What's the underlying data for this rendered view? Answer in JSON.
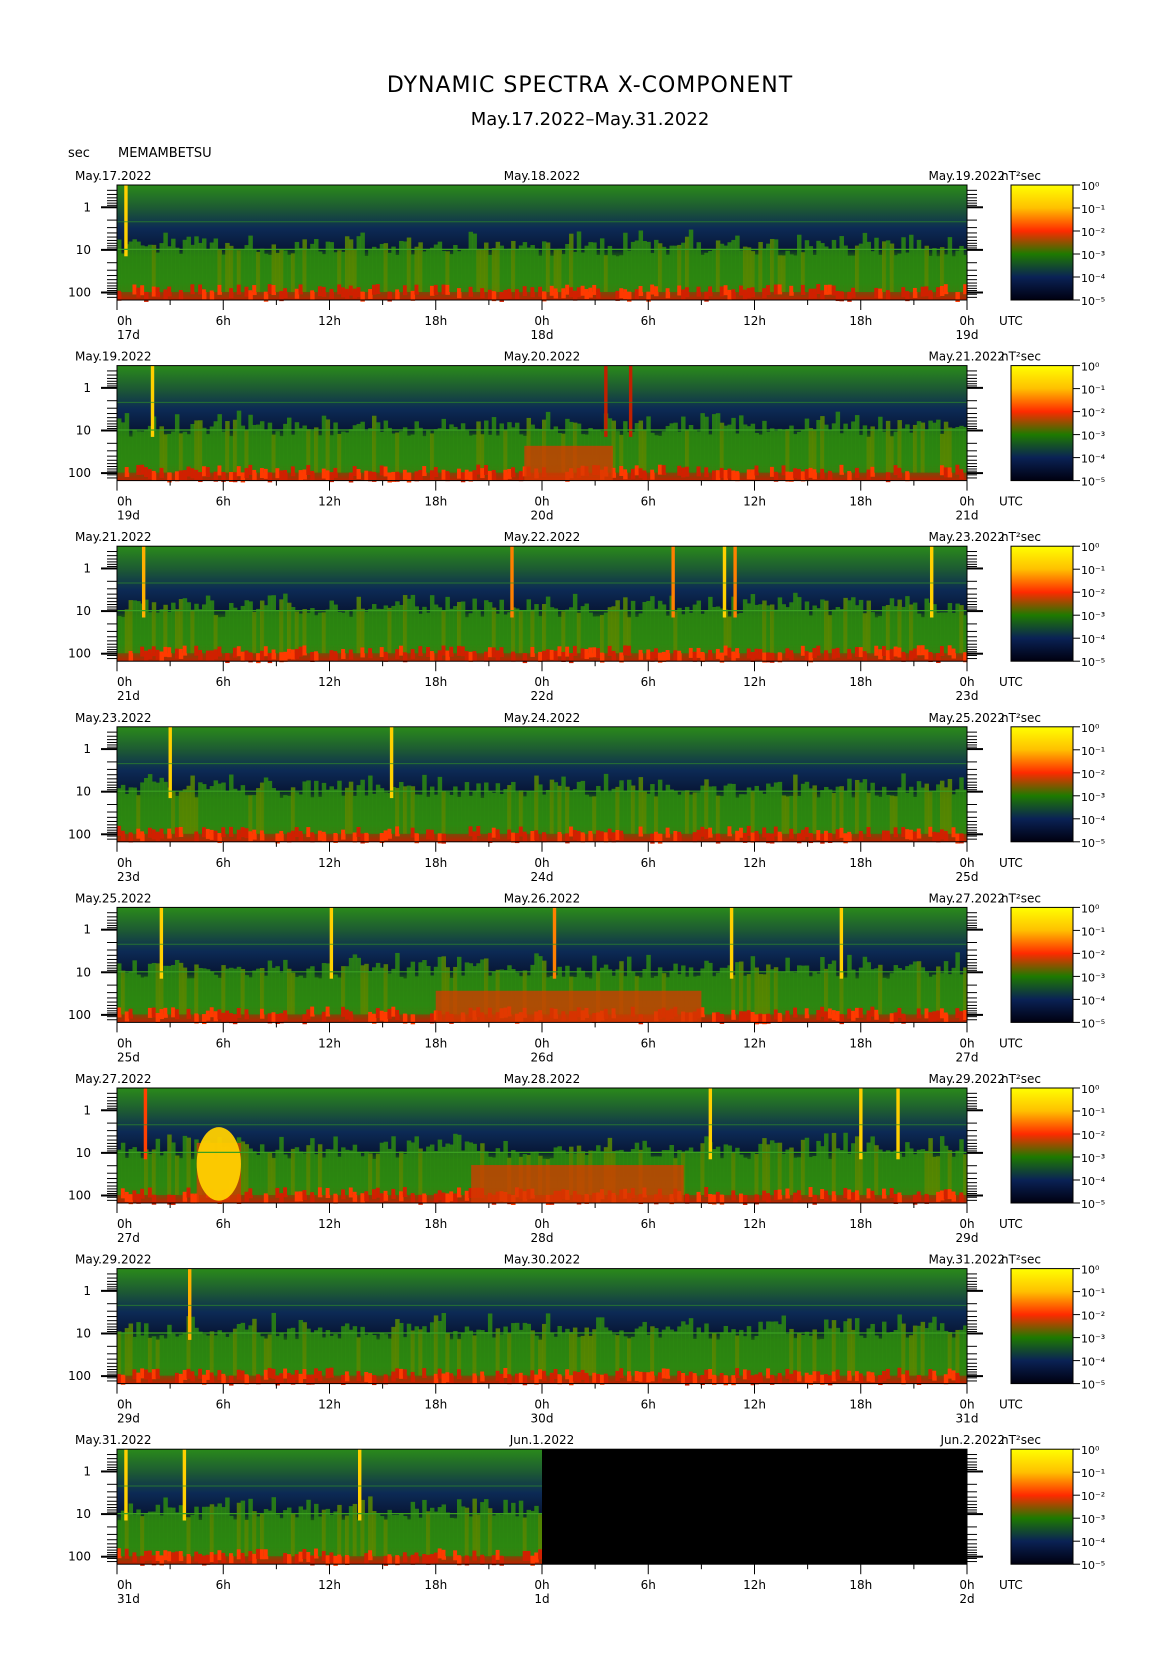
{
  "title": "DYNAMIC SPECTRA X-COMPONENT",
  "subtitle": "May.17.2022–May.31.2022",
  "y_unit": "sec",
  "station": "MEMAMBETSU",
  "time_zone": "UTC",
  "colorbar": {
    "unit": "nT²sec",
    "labels": [
      "10⁰",
      "10⁻¹",
      "10⁻²",
      "10⁻³",
      "10⁻⁴",
      "10⁻⁵"
    ],
    "colors": [
      "#ffff00",
      "#ffc000",
      "#ff2a00",
      "#1e7a00",
      "#0a2255",
      "#000010"
    ]
  },
  "chart_data": {
    "type": "heatmap",
    "x_ticks": [
      "0h",
      "6h",
      "12h",
      "18h",
      "0h",
      "6h",
      "12h",
      "18h",
      "0h"
    ],
    "y_ticks": [
      "1",
      "10",
      "100"
    ],
    "y_scale": "log",
    "panels": [
      {
        "start_date": "May.17.2022",
        "mid_date": "May.18.2022",
        "end_date": "May.19.2022",
        "day_labels": [
          "17d",
          "18d",
          "19d"
        ],
        "spikes": [
          {
            "t": 0.5,
            "top": 1,
            "color": "#ffd000"
          }
        ],
        "bursts": []
      },
      {
        "start_date": "May.19.2022",
        "mid_date": "May.20.2022",
        "end_date": "May.21.2022",
        "day_labels": [
          "19d",
          "20d",
          "21d"
        ],
        "spikes": [
          {
            "t": 2.0,
            "top": 1,
            "color": "#ffd000"
          },
          {
            "t": 27.6,
            "top": 1,
            "color": "#c02000"
          },
          {
            "t": 29.0,
            "top": 1,
            "color": "#c02000"
          }
        ],
        "bursts": [
          {
            "t0": 23.0,
            "t1": 28.0,
            "level": 0.55
          }
        ]
      },
      {
        "start_date": "May.21.2022",
        "mid_date": "May.22.2022",
        "end_date": "May.23.2022",
        "day_labels": [
          "21d",
          "22d",
          "23d"
        ],
        "spikes": [
          {
            "t": 1.5,
            "top": 1,
            "color": "#ffb000"
          },
          {
            "t": 22.3,
            "top": 1,
            "color": "#ff8000"
          },
          {
            "t": 31.4,
            "top": 1,
            "color": "#ff8000"
          },
          {
            "t": 34.3,
            "top": 1,
            "color": "#ffd000"
          },
          {
            "t": 34.9,
            "top": 1,
            "color": "#ff8000"
          },
          {
            "t": 46.0,
            "top": 1,
            "color": "#ffd000"
          }
        ],
        "bursts": []
      },
      {
        "start_date": "May.23.2022",
        "mid_date": "May.24.2022",
        "end_date": "May.25.2022",
        "day_labels": [
          "23d",
          "24d",
          "25d"
        ],
        "spikes": [
          {
            "t": 3.0,
            "top": 1,
            "color": "#ffd000"
          },
          {
            "t": 15.5,
            "top": 1,
            "color": "#ffd000"
          }
        ],
        "bursts": []
      },
      {
        "start_date": "May.25.2022",
        "mid_date": "May.26.2022",
        "end_date": "May.27.2022",
        "day_labels": [
          "25d",
          "26d",
          "27d"
        ],
        "spikes": [
          {
            "t": 2.5,
            "top": 1,
            "color": "#ffd000"
          },
          {
            "t": 12.1,
            "top": 1,
            "color": "#ffd000"
          },
          {
            "t": 24.7,
            "top": 1,
            "color": "#ff8000"
          },
          {
            "t": 34.7,
            "top": 1,
            "color": "#ffd000"
          },
          {
            "t": 40.9,
            "top": 1,
            "color": "#ffd000"
          }
        ],
        "bursts": [
          {
            "t0": 18.0,
            "t1": 33.0,
            "level": 0.5
          }
        ]
      },
      {
        "start_date": "May.27.2022",
        "mid_date": "May.28.2022",
        "end_date": "May.29.2022",
        "day_labels": [
          "27d",
          "28d",
          "29d"
        ],
        "spikes": [
          {
            "t": 1.6,
            "top": 1,
            "color": "#ff4000"
          },
          {
            "t": 33.5,
            "top": 1,
            "color": "#ffd000"
          },
          {
            "t": 42.0,
            "top": 1,
            "color": "#ffd000"
          },
          {
            "t": 44.1,
            "top": 1,
            "color": "#ffd000"
          }
        ],
        "bursts": [
          {
            "t0": 4.5,
            "t1": 7.0,
            "level": 0.95
          },
          {
            "t0": 20.0,
            "t1": 32.0,
            "level": 0.6
          }
        ]
      },
      {
        "start_date": "May.29.2022",
        "mid_date": "May.30.2022",
        "end_date": "May.31.2022",
        "day_labels": [
          "29d",
          "30d",
          "31d"
        ],
        "spikes": [
          {
            "t": 4.1,
            "top": 1,
            "color": "#ffb000"
          }
        ],
        "bursts": []
      },
      {
        "start_date": "May.31.2022",
        "mid_date": "Jun.1.2022",
        "end_date": "Jun.2.2022",
        "day_labels": [
          "31d",
          "1d",
          "2d"
        ],
        "spikes": [
          {
            "t": 0.5,
            "top": 1,
            "color": "#ffd000"
          },
          {
            "t": 3.8,
            "top": 1,
            "color": "#ffd000"
          },
          {
            "t": 13.7,
            "top": 1,
            "color": "#ffd000"
          }
        ],
        "bursts": [],
        "data_end_hour": 24
      }
    ]
  }
}
